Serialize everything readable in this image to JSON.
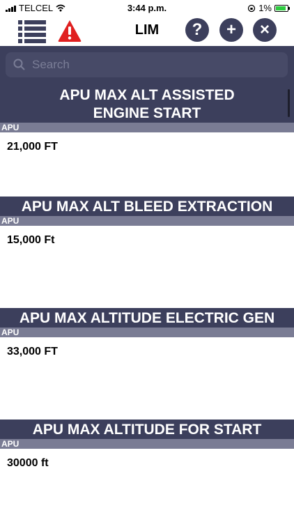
{
  "status_bar": {
    "carrier": "TELCEL",
    "time": "3:44 p.m.",
    "battery": "1%"
  },
  "toolbar": {
    "title": "LIM",
    "help_label": "?",
    "add_label": "+",
    "close_label": "×"
  },
  "search": {
    "placeholder": "Search"
  },
  "items": [
    {
      "title_line1": "APU MAX ALT ASSISTED",
      "title_line2": "ENGINE START",
      "category": "APU",
      "value": "21,000 FT"
    },
    {
      "title": "APU MAX ALT BLEED EXTRACTION",
      "category": "APU",
      "value": "15,000 Ft"
    },
    {
      "title": "APU MAX ALTITUDE ELECTRIC GEN",
      "category": "APU",
      "value": "33,000 FT"
    },
    {
      "title": "APU MAX ALTITUDE FOR START",
      "category": "APU",
      "value": "30000 ft"
    }
  ],
  "colors": {
    "header": "#3c3f5c",
    "subheader": "#7a7c94",
    "warning": "#e02020"
  }
}
